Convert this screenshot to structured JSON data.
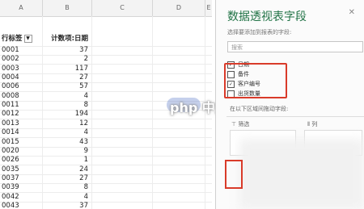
{
  "sheet": {
    "columns": [
      "A",
      "B",
      "C",
      "D",
      "E"
    ],
    "header": {
      "a": "行标签",
      "b": "计数项:日期"
    },
    "rows": [
      {
        "a": "0001",
        "b": "37"
      },
      {
        "a": "0002",
        "b": "2"
      },
      {
        "a": "0003",
        "b": "117"
      },
      {
        "a": "0004",
        "b": "27"
      },
      {
        "a": "0006",
        "b": "57"
      },
      {
        "a": "0008",
        "b": "4"
      },
      {
        "a": "0011",
        "b": "8"
      },
      {
        "a": "0012",
        "b": "194"
      },
      {
        "a": "0013",
        "b": "12"
      },
      {
        "a": "0014",
        "b": "4"
      },
      {
        "a": "0015",
        "b": "43"
      },
      {
        "a": "0020",
        "b": "9"
      },
      {
        "a": "0026",
        "b": "1"
      },
      {
        "a": "0035",
        "b": "24"
      },
      {
        "a": "0037",
        "b": "27"
      },
      {
        "a": "0039",
        "b": "8"
      },
      {
        "a": "0042",
        "b": "4"
      },
      {
        "a": "0043",
        "b": "37"
      }
    ]
  },
  "pane": {
    "title": "数据透视表字段",
    "close_icon": "close-icon",
    "subtitle": "选择要添加到报表的字段:",
    "search_placeholder": "搜索",
    "fields": [
      {
        "label": "日期",
        "checked": true,
        "mark": "✓"
      },
      {
        "label": "备件",
        "checked": false,
        "mark": ""
      },
      {
        "label": "客户编号",
        "checked": true,
        "mark": "✓"
      },
      {
        "label": "出货数量",
        "checked": false,
        "mark": ""
      }
    ],
    "hint": "在以下区域间拖动字段:",
    "filter_label": "筛选",
    "columns_label": "列"
  },
  "watermark": "php 中文网",
  "colors": {
    "accent": "#217346",
    "highlight": "#d93b2a"
  }
}
